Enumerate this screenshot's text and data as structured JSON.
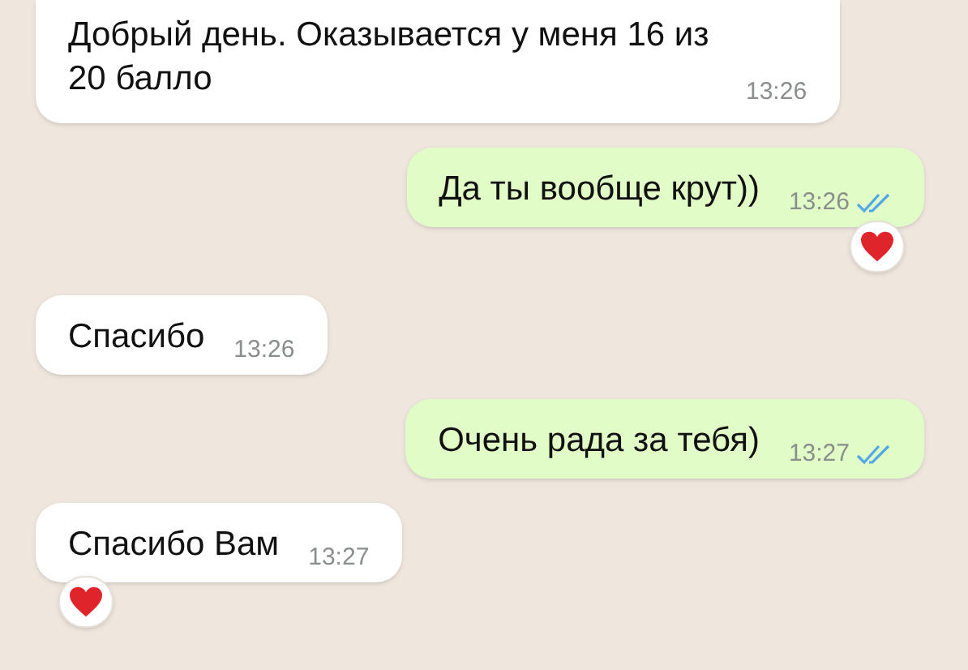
{
  "messages": [
    {
      "kind": "incoming",
      "text": "Добрый день. Оказывается у меня 16 из 20 балло",
      "time": "13:26",
      "reacted": false,
      "cut_top": true
    },
    {
      "kind": "outgoing",
      "text": "Да ты вообще крут))",
      "time": "13:26",
      "read": true,
      "reacted": true
    },
    {
      "kind": "incoming",
      "text": "Спасибо",
      "time": "13:26",
      "reacted": false
    },
    {
      "kind": "outgoing",
      "text": "Очень рада за тебя)",
      "time": "13:27",
      "read": true,
      "reacted": false
    },
    {
      "kind": "incoming",
      "text": "Спасибо Вам",
      "time": "13:27",
      "reacted": true
    }
  ]
}
